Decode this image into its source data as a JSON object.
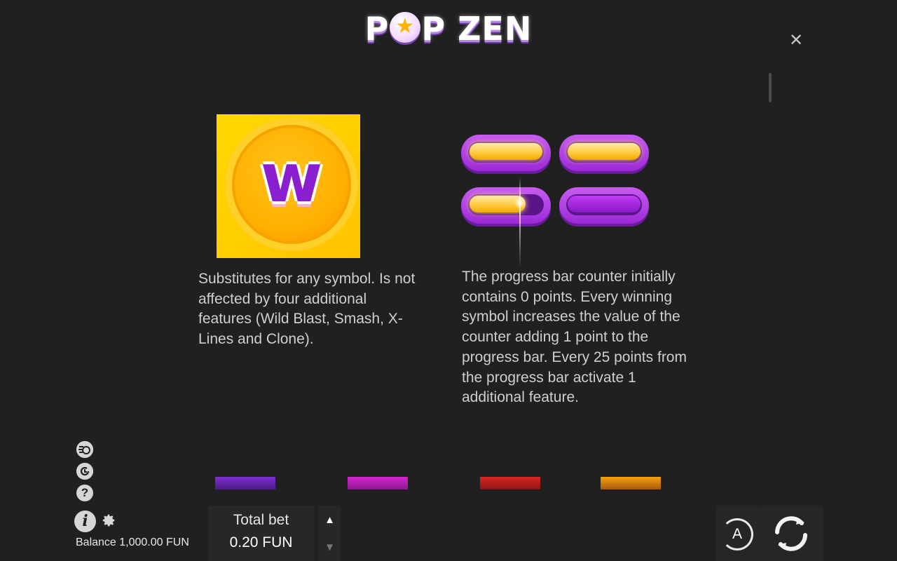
{
  "header": {
    "logo_word1_a": "P",
    "logo_word1_b": "P",
    "logo_word2": "ZEN",
    "logo_text": "POP ZEN"
  },
  "close": {
    "label": "✕",
    "icon": "close-icon"
  },
  "paytable": {
    "wild_symbol": {
      "letter": "w",
      "icon": "wild-symbol-icon"
    },
    "wild_description": "Substitutes for any symbol. Is not affected by four additional features (Wild Blast, Smash, X-Lines and Clone).",
    "progress_bar": {
      "filled_segments": 3,
      "total_segments": 4
    },
    "progress_description": "The progress bar counter initially contains 0 points. Every winning symbol increases the value of the counter adding 1 point to the progress bar. Every 25 points from the progress bar activate 1 additional feature."
  },
  "side_controls": {
    "turbo_icon": "turbo-icon",
    "history_icon": "history-icon",
    "help_label": "?",
    "info_label": "i",
    "settings_icon": "gear-icon"
  },
  "balance": {
    "text": "Balance 1,000.00 FUN"
  },
  "bet": {
    "label": "Total bet",
    "value": "0.20 FUN",
    "up_label": "▲",
    "down_label": "▼"
  },
  "autoplay": {
    "label": "A"
  },
  "colors": {
    "background": "#202020",
    "accent_purple": "#9b2ad6",
    "accent_gold": "#ffc400"
  }
}
